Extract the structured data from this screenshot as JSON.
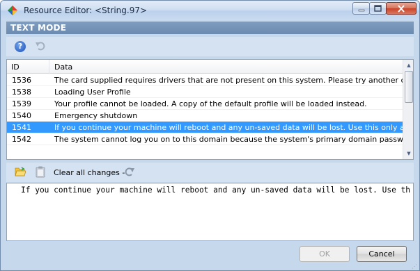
{
  "window": {
    "title": "Resource Editor: <String.97>"
  },
  "mode": {
    "label": "TEXT MODE"
  },
  "list": {
    "columns": [
      "ID",
      "Data"
    ],
    "rows": [
      {
        "id": "1536",
        "text": "The card supplied requires drivers that are not present on this system.  Please try another card."
      },
      {
        "id": "1538",
        "text": "Loading User Profile"
      },
      {
        "id": "1539",
        "text": "Your profile cannot be loaded. A copy of the default profile will be loaded instead."
      },
      {
        "id": "1540",
        "text": "Emergency shutdown"
      },
      {
        "id": "1541",
        "text": "If you continue your machine will reboot and any un-saved data will be lost.  Use this only as a last resort."
      },
      {
        "id": "1542",
        "text": "The system cannot log you on to this domain because the system's primary domain password is missing."
      }
    ],
    "selected_index": 4
  },
  "edit_toolbar": {
    "clear_label": "Clear all changes -"
  },
  "editor": {
    "value": "If you continue your machine will reboot and any un-saved data will be lost. Use this only as a last resort."
  },
  "buttons": {
    "ok": "OK",
    "cancel": "Cancel"
  },
  "colors": {
    "selection": "#3399ff",
    "mode_header": "#7395bc"
  }
}
